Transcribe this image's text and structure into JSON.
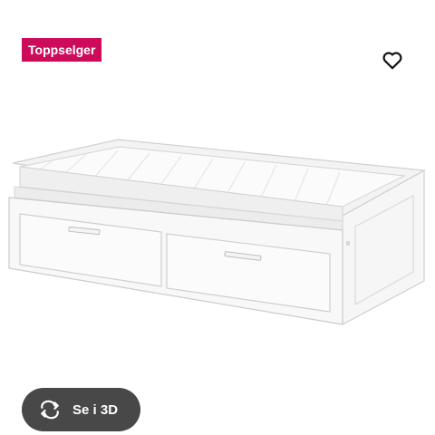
{
  "badge": {
    "label": "Toppselger",
    "color": "#cc0c5a"
  },
  "favorite": {
    "icon": "heart-outline-icon"
  },
  "product_image": {
    "alt": ""
  },
  "view_3d": {
    "label": "Se i 3D",
    "icon": "rotate-arrows-icon"
  }
}
